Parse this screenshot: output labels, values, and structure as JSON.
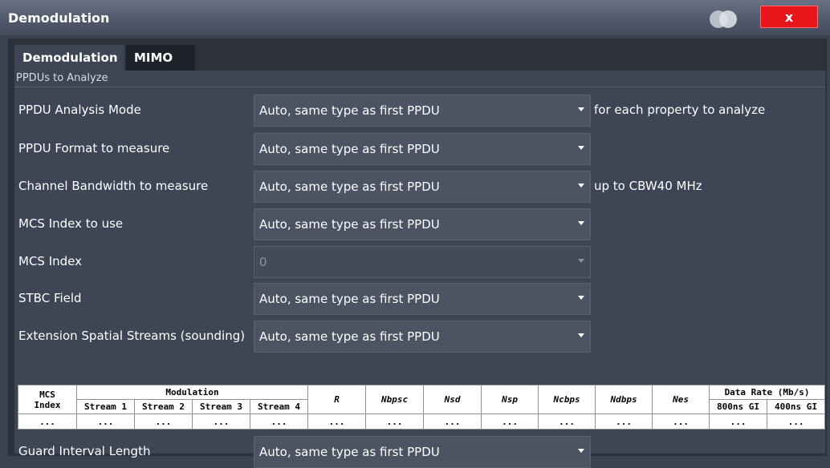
{
  "window": {
    "title": "Demodulation",
    "close_label": "x"
  },
  "tabs": [
    {
      "label": "Demodulation",
      "active": true
    },
    {
      "label": "MIMO",
      "active": false
    }
  ],
  "section": {
    "label": "PPDUs to Analyze"
  },
  "rows": [
    {
      "label": "PPDU Analysis Mode",
      "value": "Auto, same type as first PPDU",
      "note": "for each property to analyze",
      "enabled": true
    },
    {
      "label": "PPDU Format to measure",
      "value": "Auto, same type as first PPDU",
      "note": "",
      "enabled": true
    },
    {
      "label": "Channel Bandwidth to measure",
      "value": "Auto, same type as first PPDU",
      "note": "up to CBW40 MHz",
      "enabled": true
    },
    {
      "label": "MCS Index to use",
      "value": "Auto, same type as first PPDU",
      "note": "",
      "enabled": true
    },
    {
      "label": "MCS Index",
      "value": "0",
      "note": "",
      "enabled": false
    },
    {
      "label": "STBC Field",
      "value": "Auto, same type as first PPDU",
      "note": "",
      "enabled": true
    },
    {
      "label": "Extension Spatial Streams (sounding)",
      "value": "Auto, same type as first PPDU",
      "note": "",
      "enabled": true
    }
  ],
  "table": {
    "mcs_header": "MCS",
    "mcs_header2": "Index",
    "modulation_header": "Modulation",
    "streams": [
      "Stream 1",
      "Stream 2",
      "Stream 3",
      "Stream 4"
    ],
    "r_header": "R",
    "nbpsc": "Nbpsc",
    "nsd": "Nsd",
    "nsp": "Nsp",
    "ncbps": "Ncbps",
    "ndbps": "Ndbps",
    "nes": "Nes",
    "data_rate_header": "Data Rate (Mb/s)",
    "gi800": "800ns GI",
    "gi400": "400ns GI",
    "placeholder": "..."
  },
  "guard": {
    "label": "Guard Interval Length",
    "value": "Auto, same type as first PPDU"
  },
  "colors": {
    "close_button": "#e8151b",
    "dropdown_bg": "#4c5464",
    "panel_bg": "#3e4554"
  }
}
